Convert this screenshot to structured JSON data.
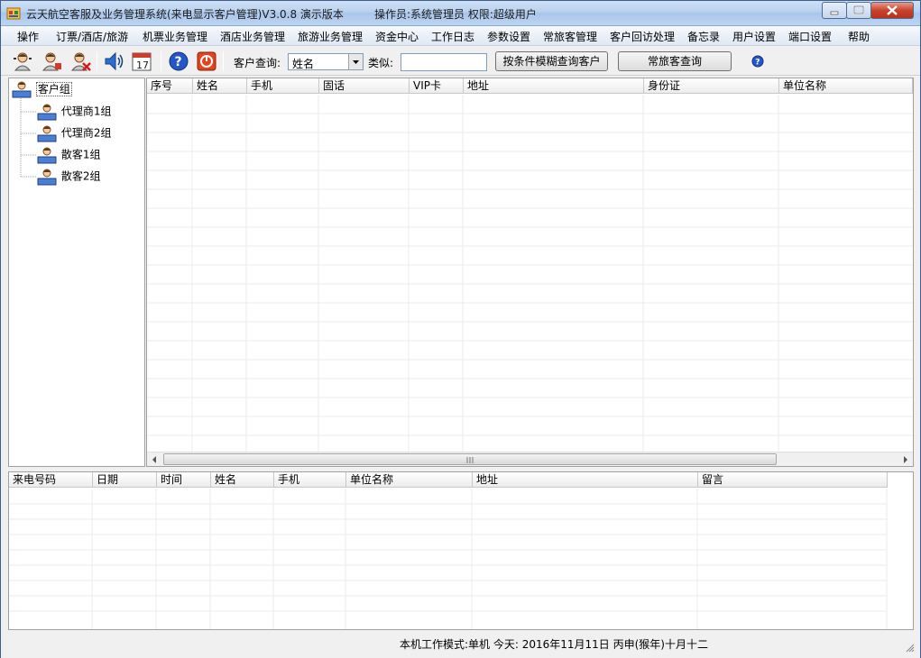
{
  "window": {
    "title": "云天航空客服及业务管理系统(来电显示客户管理)V3.0.8 演示版本",
    "operator": "操作员:系统管理员  权限:超级用户"
  },
  "menu": [
    "操作",
    "订票/酒店/旅游",
    "机票业务管理",
    "酒店业务管理",
    "旅游业务管理",
    "资金中心",
    "工作日志",
    "参数设置",
    "常旅客管理",
    "客户回访处理",
    "备忘录",
    "用户设置",
    "端口设置",
    "帮助"
  ],
  "toolbar": {
    "query_label": "客户查询:",
    "query_field": "姓名",
    "like_label": "类似:",
    "like_value": "",
    "fuzzy_button": "按条件模糊查询客户",
    "frequent_button": "常旅客查询"
  },
  "tree": {
    "root": "客户组",
    "children": [
      "代理商1组",
      "代理商2组",
      "散客1组",
      "散客2组"
    ]
  },
  "customer_table": {
    "columns": [
      "序号",
      "姓名",
      "手机",
      "固话",
      "VIP卡",
      "地址",
      "身份证",
      "单位名称"
    ],
    "rows": []
  },
  "call_table": {
    "columns": [
      "来电号码",
      "日期",
      "时间",
      "姓名",
      "手机",
      "单位名称",
      "地址",
      "留言"
    ],
    "rows": []
  },
  "statusbar": {
    "text": "本机工作模式:单机   今天: 2016年11月11日 丙申(猴年)十月十二"
  },
  "colors": {
    "title_bar": "#b9d1ee",
    "close_button": "#c9432c",
    "grid_line": "#e8e8e8"
  },
  "icons": [
    "user-icon",
    "user-edit-icon",
    "user-delete-icon",
    "speaker-icon",
    "calendar-icon",
    "help-icon",
    "power-icon",
    "help-small-icon"
  ]
}
